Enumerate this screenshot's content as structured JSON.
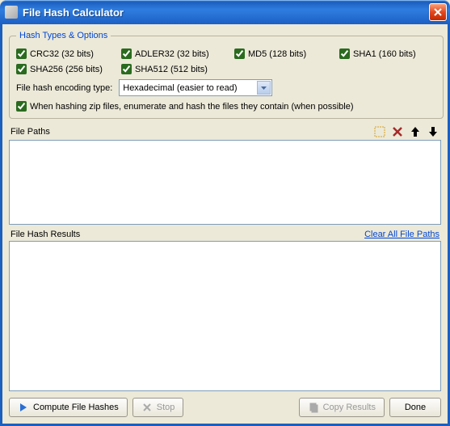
{
  "window": {
    "title": "File Hash Calculator"
  },
  "options": {
    "legend": "Hash Types & Options",
    "hash_types": {
      "crc32": "CRC32 (32 bits)",
      "adler32": "ADLER32 (32 bits)",
      "md5": "MD5 (128 bits)",
      "sha1": "SHA1 (160 bits)",
      "sha256": "SHA256 (256 bits)",
      "sha512": "SHA512 (512 bits)"
    },
    "encoding_label": "File hash encoding type:",
    "encoding_value": "Hexadecimal (easier to read)",
    "zip_enumerate": "When hashing zip files, enumerate and hash the files they contain (when possible)"
  },
  "filepaths": {
    "label": "File Paths"
  },
  "results": {
    "label": "File Hash Results",
    "clear_link": "Clear All File Paths"
  },
  "buttons": {
    "compute": "Compute File Hashes",
    "stop": "Stop",
    "copy": "Copy Results",
    "done": "Done"
  }
}
